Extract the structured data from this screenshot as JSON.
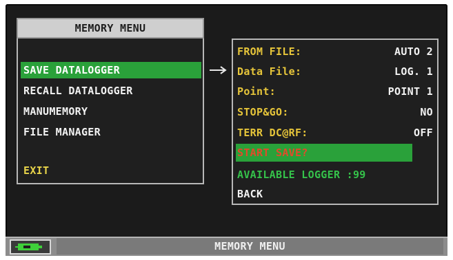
{
  "left_menu": {
    "title": "MEMORY MENU",
    "items": [
      {
        "label": "SAVE DATALOGGER"
      },
      {
        "label": "RECALL DATALOGGER"
      },
      {
        "label": "MANUMEMORY"
      },
      {
        "label": "FILE MANAGER"
      }
    ],
    "exit_label": "EXIT"
  },
  "right_panel": {
    "rows": [
      {
        "label": "FROM FILE:",
        "value": "AUTO 2"
      },
      {
        "label": "Data File:",
        "value": "LOG. 1"
      },
      {
        "label": "Point:",
        "value": "POINT 1"
      },
      {
        "label": "STOP&GO:",
        "value": "NO"
      },
      {
        "label": "TERR DC@RF:",
        "value": "OFF"
      }
    ],
    "start_save_label": "START SAVE?",
    "available_label": "AVAILABLE LOGGER :99",
    "back_label": "BACK"
  },
  "status_bar": {
    "title": "MEMORY MENU",
    "battery_icon": "battery-icon"
  },
  "colors": {
    "selection": "#2aa13a",
    "label_yellow": "#e6c53a",
    "start_save_text": "#e24a2a",
    "available_green": "#35c24a",
    "screen_bg": "#1b1b1b"
  }
}
